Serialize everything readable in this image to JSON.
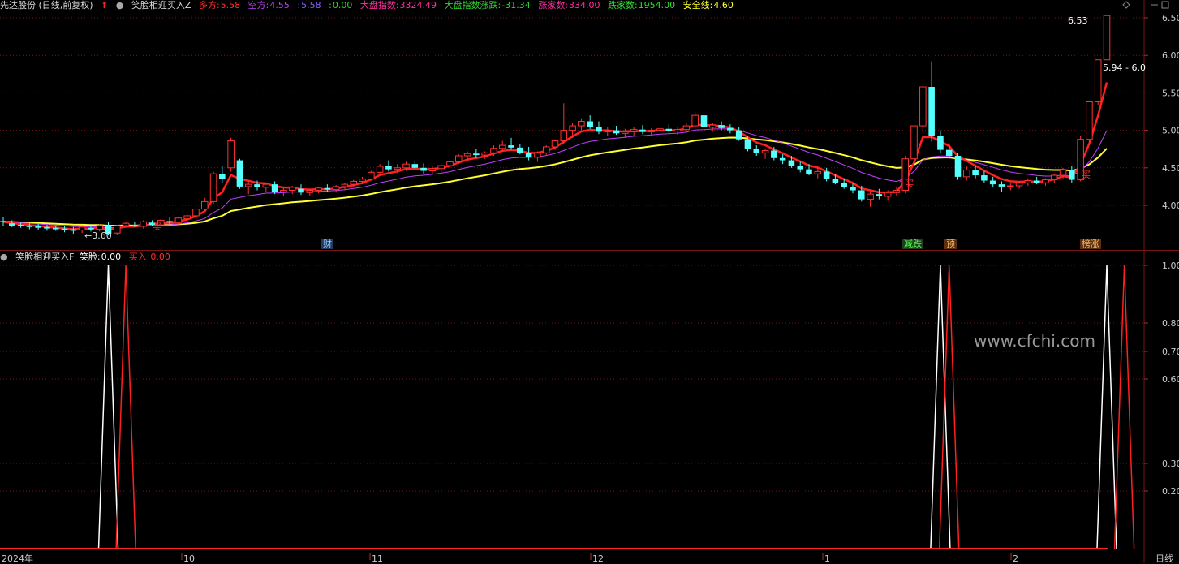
{
  "header": {
    "stock": "先达股份 (日线,前复权)",
    "indicator": "笑脸相迎买入Z",
    "duofang_label": "多方:",
    "duofang_value": "5.58",
    "kongfang_label": "空方:",
    "kongfang_value": "4.55",
    "v3_label": ":",
    "v3_value": "5.58",
    "v4_label": ":",
    "v4_value": "0.00",
    "dapan_label": "大盘指数:",
    "dapan_value": "3324.49",
    "dapan_chg_label": "大盘指数涨跌:",
    "dapan_chg_value": "-31.34",
    "up_label": "涨家数:",
    "up_value": "334.00",
    "down_label": "跌家数:",
    "down_value": "1954.00",
    "safe_label": "安全线:",
    "safe_value": "4.60"
  },
  "sub_header": {
    "indicator": "笑脸相迎买入F",
    "smile_label": "笑脸:",
    "smile_value": "0.00",
    "buy_label": "买入:",
    "buy_value": "0.00"
  },
  "watermark": "www.cfchi.com",
  "annotations": {
    "low_price": "←3.60",
    "high_price": "6.53",
    "range_text": "5.94 - 6.0",
    "buy_1": "买",
    "buy_2": "↑买",
    "buy_3": "买",
    "tag_cai": "财",
    "tag_jiandie": "减跌",
    "tag_yu": "预",
    "tag_bangzhang": "榜涨"
  },
  "period_label": "日线",
  "colors": {
    "up": "#ff3232",
    "down": "#54ffff",
    "ma_red": "#ff2020",
    "ma_purple": "#c040ff",
    "ma_yellow": "#ffff30",
    "grid": "#7a1515",
    "smile": "#ffffff",
    "buy": "#ff2020"
  },
  "chart_data": [
    {
      "type": "candlestick",
      "title": "笑脸相迎买入Z",
      "x_labels": [
        "2024年",
        "10",
        "11",
        "12",
        "1",
        "2"
      ],
      "ylim": [
        3.5,
        6.6
      ],
      "y_ticks": [
        "4.00",
        "4.50",
        "5.00",
        "5.50",
        "6.00",
        "6.50"
      ],
      "candles": [
        [
          3.79,
          3.84,
          3.73,
          3.78
        ],
        [
          3.76,
          3.8,
          3.71,
          3.73
        ],
        [
          3.74,
          3.77,
          3.7,
          3.72
        ],
        [
          3.73,
          3.76,
          3.68,
          3.71
        ],
        [
          3.72,
          3.75,
          3.67,
          3.7
        ],
        [
          3.71,
          3.74,
          3.66,
          3.69
        ],
        [
          3.7,
          3.73,
          3.66,
          3.68
        ],
        [
          3.69,
          3.72,
          3.64,
          3.67
        ],
        [
          3.68,
          3.71,
          3.62,
          3.66
        ],
        [
          3.67,
          3.72,
          3.63,
          3.71
        ],
        [
          3.7,
          3.73,
          3.65,
          3.68
        ],
        [
          3.68,
          3.75,
          3.65,
          3.73
        ],
        [
          3.73,
          3.78,
          3.6,
          3.62
        ],
        [
          3.63,
          3.74,
          3.6,
          3.73
        ],
        [
          3.73,
          3.78,
          3.7,
          3.76
        ],
        [
          3.74,
          3.78,
          3.71,
          3.72
        ],
        [
          3.72,
          3.8,
          3.69,
          3.78
        ],
        [
          3.77,
          3.8,
          3.72,
          3.74
        ],
        [
          3.74,
          3.82,
          3.72,
          3.8
        ],
        [
          3.79,
          3.84,
          3.75,
          3.77
        ],
        [
          3.77,
          3.85,
          3.74,
          3.83
        ],
        [
          3.82,
          3.88,
          3.79,
          3.86
        ],
        [
          3.86,
          3.96,
          3.84,
          3.95
        ],
        [
          3.95,
          4.1,
          3.92,
          4.05
        ],
        [
          4.05,
          4.45,
          4.02,
          4.42
        ],
        [
          4.42,
          4.52,
          4.3,
          4.35
        ],
        [
          4.5,
          4.9,
          4.45,
          4.86
        ],
        [
          4.6,
          4.62,
          4.22,
          4.25
        ],
        [
          4.25,
          4.32,
          4.15,
          4.28
        ],
        [
          4.28,
          4.33,
          4.2,
          4.24
        ],
        [
          4.24,
          4.3,
          4.18,
          4.28
        ],
        [
          4.28,
          4.32,
          4.15,
          4.18
        ],
        [
          4.18,
          4.24,
          4.12,
          4.2
        ],
        [
          4.2,
          4.26,
          4.15,
          4.24
        ],
        [
          4.22,
          4.28,
          4.14,
          4.17
        ],
        [
          4.17,
          4.22,
          4.13,
          4.2
        ],
        [
          4.2,
          4.25,
          4.16,
          4.23
        ],
        [
          4.23,
          4.28,
          4.18,
          4.21
        ],
        [
          4.21,
          4.27,
          4.17,
          4.25
        ],
        [
          4.25,
          4.3,
          4.2,
          4.28
        ],
        [
          4.28,
          4.34,
          4.24,
          4.32
        ],
        [
          4.32,
          4.38,
          4.28,
          4.35
        ],
        [
          4.35,
          4.46,
          4.33,
          4.44
        ],
        [
          4.44,
          4.55,
          4.41,
          4.52
        ],
        [
          4.52,
          4.6,
          4.45,
          4.48
        ],
        [
          4.48,
          4.55,
          4.43,
          4.5
        ],
        [
          4.5,
          4.58,
          4.46,
          4.55
        ],
        [
          4.55,
          4.6,
          4.48,
          4.5
        ],
        [
          4.5,
          4.56,
          4.42,
          4.46
        ],
        [
          4.46,
          4.52,
          4.41,
          4.49
        ],
        [
          4.49,
          4.55,
          4.45,
          4.53
        ],
        [
          4.53,
          4.6,
          4.5,
          4.58
        ],
        [
          4.58,
          4.68,
          4.55,
          4.66
        ],
        [
          4.66,
          4.72,
          4.6,
          4.69
        ],
        [
          4.69,
          4.75,
          4.63,
          4.67
        ],
        [
          4.67,
          4.72,
          4.62,
          4.7
        ],
        [
          4.7,
          4.8,
          4.66,
          4.76
        ],
        [
          4.76,
          4.86,
          4.72,
          4.8
        ],
        [
          4.8,
          4.9,
          4.74,
          4.77
        ],
        [
          4.77,
          4.82,
          4.68,
          4.7
        ],
        [
          4.7,
          4.78,
          4.6,
          4.64
        ],
        [
          4.64,
          4.72,
          4.58,
          4.7
        ],
        [
          4.7,
          4.8,
          4.66,
          4.78
        ],
        [
          4.78,
          4.88,
          4.74,
          4.86
        ],
        [
          4.86,
          5.36,
          4.82,
          5.0
        ],
        [
          5.0,
          5.1,
          4.9,
          5.06
        ],
        [
          5.06,
          5.15,
          5.0,
          5.12
        ],
        [
          5.12,
          5.2,
          5.02,
          5.05
        ],
        [
          5.05,
          5.12,
          4.95,
          4.98
        ],
        [
          4.98,
          5.04,
          4.92,
          5.0
        ],
        [
          5.0,
          5.06,
          4.94,
          4.96
        ],
        [
          4.96,
          5.02,
          4.9,
          4.98
        ],
        [
          4.98,
          5.04,
          4.92,
          5.01
        ],
        [
          5.01,
          5.07,
          4.95,
          4.98
        ],
        [
          4.98,
          5.03,
          4.93,
          5.0
        ],
        [
          5.0,
          5.06,
          4.96,
          5.02
        ],
        [
          5.02,
          5.08,
          4.97,
          4.99
        ],
        [
          4.99,
          5.05,
          4.94,
          5.01
        ],
        [
          5.01,
          5.1,
          4.98,
          5.06
        ],
        [
          5.06,
          5.24,
          5.02,
          5.2
        ],
        [
          5.2,
          5.25,
          5.0,
          5.04
        ],
        [
          5.04,
          5.1,
          4.98,
          5.07
        ],
        [
          5.07,
          5.12,
          5.0,
          5.03
        ],
        [
          5.03,
          5.08,
          4.96,
          5.0
        ],
        [
          5.0,
          5.04,
          4.86,
          4.88
        ],
        [
          4.88,
          4.92,
          4.72,
          4.75
        ],
        [
          4.75,
          4.8,
          4.66,
          4.7
        ],
        [
          4.7,
          4.76,
          4.62,
          4.73
        ],
        [
          4.73,
          4.78,
          4.6,
          4.63
        ],
        [
          4.63,
          4.68,
          4.55,
          4.6
        ],
        [
          4.6,
          4.66,
          4.5,
          4.52
        ],
        [
          4.52,
          4.58,
          4.44,
          4.48
        ],
        [
          4.48,
          4.55,
          4.4,
          4.42
        ],
        [
          4.42,
          4.5,
          4.36,
          4.45
        ],
        [
          4.45,
          4.5,
          4.32,
          4.35
        ],
        [
          4.35,
          4.42,
          4.28,
          4.3
        ],
        [
          4.3,
          4.36,
          4.22,
          4.24
        ],
        [
          4.24,
          4.3,
          4.16,
          4.2
        ],
        [
          4.2,
          4.26,
          4.05,
          4.08
        ],
        [
          4.08,
          4.18,
          3.98,
          4.15
        ],
        [
          4.15,
          4.22,
          4.08,
          4.12
        ],
        [
          4.12,
          4.2,
          4.06,
          4.17
        ],
        [
          4.17,
          4.24,
          4.12,
          4.2
        ],
        [
          4.2,
          4.66,
          4.16,
          4.62
        ],
        [
          4.62,
          5.12,
          4.58,
          5.06
        ],
        [
          5.06,
          5.6,
          5.0,
          5.58
        ],
        [
          5.58,
          5.92,
          4.85,
          4.92
        ],
        [
          4.92,
          5.0,
          4.7,
          4.74
        ],
        [
          4.74,
          4.82,
          4.62,
          4.66
        ],
        [
          4.66,
          4.7,
          4.34,
          4.38
        ],
        [
          4.38,
          4.52,
          4.33,
          4.47
        ],
        [
          4.47,
          4.52,
          4.36,
          4.4
        ],
        [
          4.4,
          4.46,
          4.3,
          4.33
        ],
        [
          4.33,
          4.38,
          4.25,
          4.28
        ],
        [
          4.28,
          4.32,
          4.18,
          4.25
        ],
        [
          4.25,
          4.3,
          4.2,
          4.26
        ],
        [
          4.26,
          4.32,
          4.22,
          4.3
        ],
        [
          4.3,
          4.36,
          4.26,
          4.33
        ],
        [
          4.33,
          4.38,
          4.28,
          4.3
        ],
        [
          4.3,
          4.36,
          4.26,
          4.34
        ],
        [
          4.34,
          4.42,
          4.3,
          4.4
        ],
        [
          4.4,
          4.5,
          4.36,
          4.47
        ],
        [
          4.47,
          4.52,
          4.3,
          4.34
        ],
        [
          4.34,
          4.92,
          4.32,
          4.88
        ],
        [
          4.88,
          5.38,
          4.84,
          5.38
        ],
        [
          5.38,
          5.94,
          5.34,
          5.94
        ],
        [
          5.94,
          6.53,
          5.94,
          6.53
        ]
      ],
      "ma_red_label": "多方",
      "ma_purple_label": "空方",
      "ma_yellow_label": "安全线"
    },
    {
      "type": "line",
      "title": "笑脸相迎买入F",
      "ylim": [
        0,
        1
      ],
      "y_ticks": [
        "0.20",
        "0.30",
        "0.60",
        "0.70",
        "0.80",
        "1.00"
      ],
      "series": [
        {
          "name": "笑脸",
          "spikes_at": [
            12,
            107,
            126
          ],
          "peak": 1.0
        },
        {
          "name": "买入",
          "spikes_at": [
            14,
            108,
            128
          ],
          "peak": 1.0
        }
      ]
    }
  ]
}
